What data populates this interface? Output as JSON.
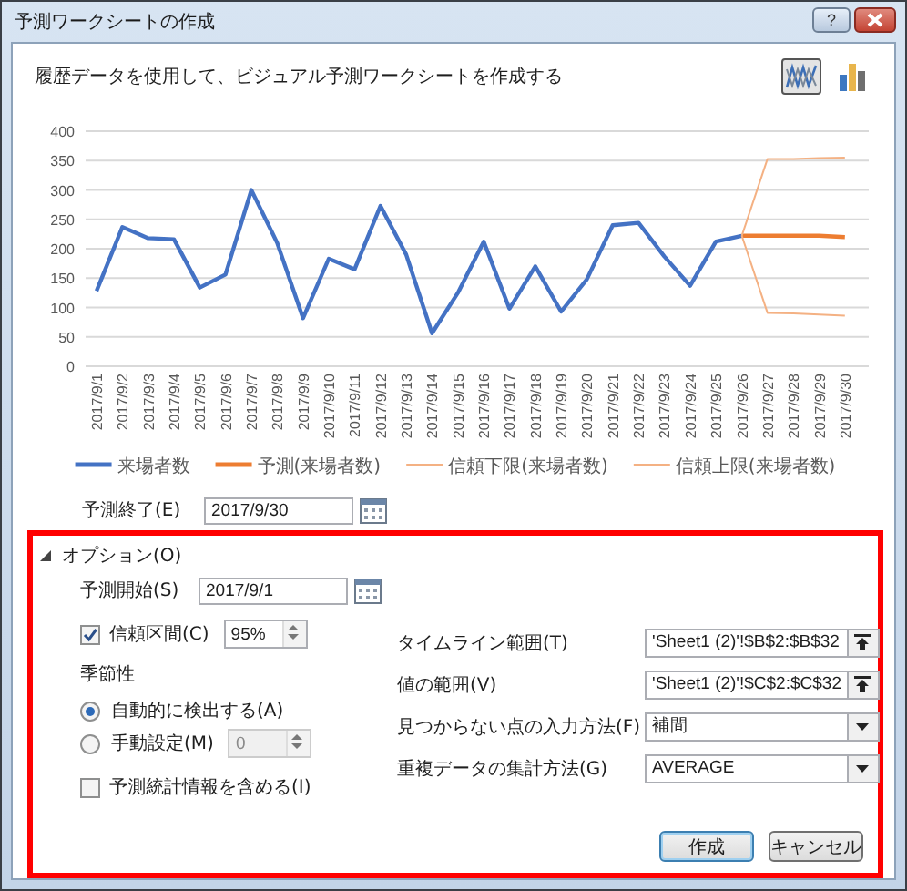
{
  "window": {
    "title": "予測ワークシートの作成",
    "title_buttons": [
      {
        "kind": "help",
        "label": "?"
      },
      {
        "kind": "close"
      }
    ]
  },
  "description": "履歴データを使用して、ビジュアル予測ワークシートを作成する",
  "chart_types": [
    {
      "kind": "line",
      "selected": true
    },
    {
      "kind": "column",
      "selected": false
    }
  ],
  "chart": {
    "chart_data": {
      "type": "line",
      "categories": [
        "2017/9/1",
        "2017/9/2",
        "2017/9/3",
        "2017/9/4",
        "2017/9/5",
        "2017/9/6",
        "2017/9/7",
        "2017/9/8",
        "2017/9/9",
        "2017/9/10",
        "2017/9/11",
        "2017/9/12",
        "2017/9/13",
        "2017/9/14",
        "2017/9/15",
        "2017/9/16",
        "2017/9/17",
        "2017/9/18",
        "2017/9/19",
        "2017/9/20",
        "2017/9/21",
        "2017/9/22",
        "2017/9/23",
        "2017/9/24",
        "2017/9/25",
        "2017/9/26",
        "2017/9/27",
        "2017/9/28",
        "2017/9/29",
        "2017/9/30"
      ],
      "grid": true,
      "legend": true,
      "ylim": [
        0,
        400
      ],
      "yticks": [
        0,
        50,
        100,
        150,
        200,
        250,
        300,
        350,
        400
      ],
      "series": [
        {
          "name": "来場者数",
          "color": "#4472c4",
          "values": [
            128,
            237,
            218,
            216,
            134,
            156,
            300,
            210,
            82,
            183,
            165,
            273,
            190,
            56,
            125,
            212,
            98,
            170,
            93,
            148,
            240,
            244,
            187,
            137,
            212,
            222,
            null,
            null,
            null,
            null
          ]
        },
        {
          "name": "予測(来場者数)",
          "color": "#ed7d31",
          "values": [
            null,
            null,
            null,
            null,
            null,
            null,
            null,
            null,
            null,
            null,
            null,
            null,
            null,
            null,
            null,
            null,
            null,
            null,
            null,
            null,
            null,
            null,
            null,
            null,
            null,
            222,
            222,
            222,
            222,
            220
          ]
        },
        {
          "name": "信頼下限(来場者数)",
          "color": "#f4b183",
          "values": [
            null,
            null,
            null,
            null,
            null,
            null,
            null,
            null,
            null,
            null,
            null,
            null,
            null,
            null,
            null,
            null,
            null,
            null,
            null,
            null,
            null,
            null,
            null,
            null,
            null,
            222,
            91,
            90,
            88,
            86
          ]
        },
        {
          "name": "信頼上限(来場者数)",
          "color": "#f4b183",
          "values": [
            null,
            null,
            null,
            null,
            null,
            null,
            null,
            null,
            null,
            null,
            null,
            null,
            null,
            null,
            null,
            null,
            null,
            null,
            null,
            null,
            null,
            null,
            null,
            null,
            null,
            222,
            353,
            353,
            354,
            355
          ]
        }
      ]
    }
  },
  "forecast_end": {
    "label": "予測終了(E)",
    "value": "2017/9/30"
  },
  "options": {
    "label": "オプション(O)",
    "expanded": true,
    "forecast_start": {
      "label": "予測開始(S)",
      "value": "2017/9/1"
    },
    "confidence": {
      "label": "信頼区間(C)",
      "checked": true,
      "value": "95%"
    },
    "seasonality": {
      "label": "季節性",
      "choices": [
        {
          "label": "自動的に検出する(A)",
          "selected": true
        },
        {
          "label": "手動設定(M)",
          "selected": false,
          "value": "0",
          "disabled": true
        }
      ]
    },
    "include_stats": {
      "label": "予測統計情報を含める(I)",
      "checked": false
    },
    "fields": [
      {
        "kind": "range",
        "label": "タイムライン範囲(T)",
        "value": "'Sheet1 (2)'!$B$2:$B$32"
      },
      {
        "kind": "range",
        "label": "値の範囲(V)",
        "value": "'Sheet1 (2)'!$C$2:$C$32"
      },
      {
        "kind": "dropdown",
        "label": "見つからない点の入力方法(F)",
        "value": "補間"
      },
      {
        "kind": "dropdown",
        "label": "重複データの集計方法(G)",
        "value": "AVERAGE"
      }
    ]
  },
  "buttons": [
    {
      "label": "作成",
      "default": true
    },
    {
      "label": "キャンセル",
      "default": false
    }
  ]
}
